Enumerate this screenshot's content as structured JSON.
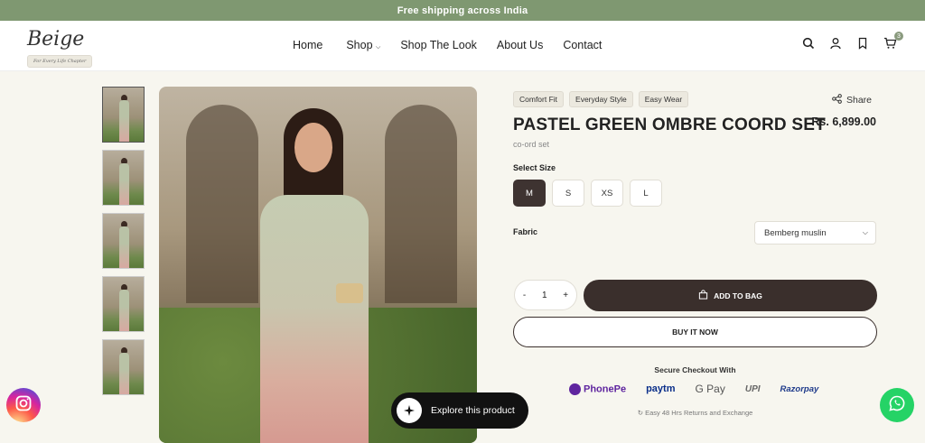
{
  "announcement": "Free shipping across India",
  "brand": {
    "name": "Beige",
    "tagline": "For Every Life Chapter"
  },
  "nav": [
    "Home",
    "Shop",
    "Shop The Look",
    "About Us",
    "Contact"
  ],
  "cart_count": "3",
  "product": {
    "tags": [
      "Comfort Fit",
      "Everyday Style",
      "Easy Wear"
    ],
    "share_label": "Share",
    "title": "PASTEL GREEN OMBRE COORD SET",
    "price": "Rs. 6,899.00",
    "subtitle": "co-ord set",
    "size_label": "Select Size",
    "sizes": [
      "M",
      "S",
      "XS",
      "L"
    ],
    "selected_size": "M",
    "fabric_label": "Fabric",
    "fabric_value": "Bemberg muslin",
    "quantity": "1",
    "add_to_bag": "ADD TO BAG",
    "buy_now": "BUY IT NOW"
  },
  "checkout": {
    "heading": "Secure Checkout With",
    "methods": [
      "PhonePe",
      "paytm",
      "G Pay",
      "UPI",
      "Razorpay"
    ],
    "returns": "Easy 48 Hrs Returns and Exchange"
  },
  "explore_label": "Explore this product",
  "colors": {
    "topbar": "#7f9871",
    "button_dark": "#3a2f2c",
    "background": "#f7f6ef"
  }
}
